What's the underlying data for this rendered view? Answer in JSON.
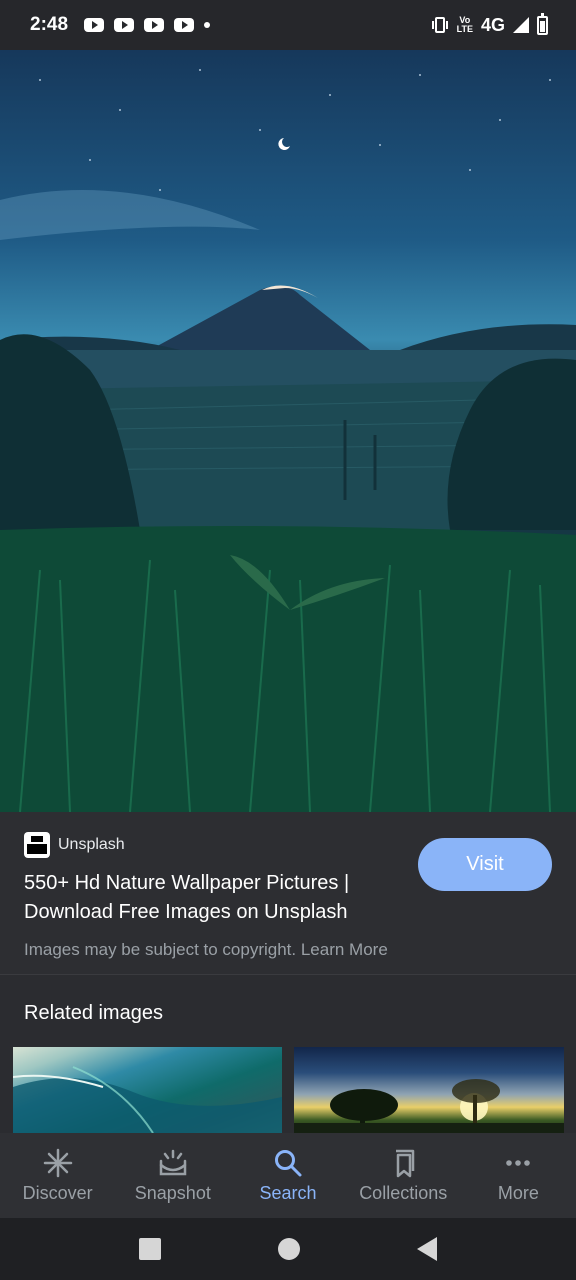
{
  "status_bar": {
    "time": "2:48",
    "network": "4G",
    "volte": "Vo\nLTE",
    "notifications": [
      "youtube-icon",
      "youtube-icon",
      "youtube-icon",
      "youtube-icon",
      "dot-icon"
    ]
  },
  "result": {
    "source_name": "Unsplash",
    "title": "550+ Hd Nature Wallpaper Pictures | Download Free Images on Unsplash",
    "visit_label": "Visit",
    "copyright_text": "Images may be subject to copyright. Learn More"
  },
  "related": {
    "heading": "Related images"
  },
  "bottom_nav": {
    "items": [
      {
        "label": "Discover",
        "icon": "asterisk-icon",
        "active": false
      },
      {
        "label": "Snapshot",
        "icon": "snapshot-icon",
        "active": false
      },
      {
        "label": "Search",
        "icon": "search-icon",
        "active": true
      },
      {
        "label": "Collections",
        "icon": "bookmarks-icon",
        "active": false
      },
      {
        "label": "More",
        "icon": "more-dots-icon",
        "active": false
      }
    ]
  },
  "colors": {
    "accent": "#8ab4f8",
    "background": "#2b2c30"
  }
}
